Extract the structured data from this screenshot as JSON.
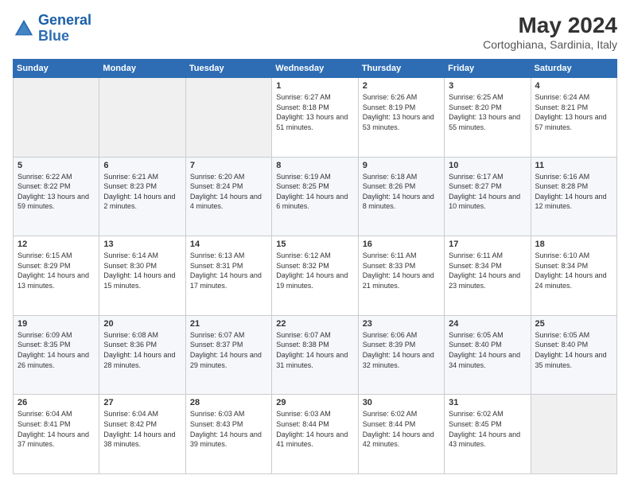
{
  "logo": {
    "line1": "General",
    "line2": "Blue"
  },
  "title": "May 2024",
  "subtitle": "Cortoghiana, Sardinia, Italy",
  "days_of_week": [
    "Sunday",
    "Monday",
    "Tuesday",
    "Wednesday",
    "Thursday",
    "Friday",
    "Saturday"
  ],
  "weeks": [
    [
      {
        "day": "",
        "sunrise": "",
        "sunset": "",
        "daylight": ""
      },
      {
        "day": "",
        "sunrise": "",
        "sunset": "",
        "daylight": ""
      },
      {
        "day": "",
        "sunrise": "",
        "sunset": "",
        "daylight": ""
      },
      {
        "day": "1",
        "sunrise": "Sunrise: 6:27 AM",
        "sunset": "Sunset: 8:18 PM",
        "daylight": "Daylight: 13 hours and 51 minutes."
      },
      {
        "day": "2",
        "sunrise": "Sunrise: 6:26 AM",
        "sunset": "Sunset: 8:19 PM",
        "daylight": "Daylight: 13 hours and 53 minutes."
      },
      {
        "day": "3",
        "sunrise": "Sunrise: 6:25 AM",
        "sunset": "Sunset: 8:20 PM",
        "daylight": "Daylight: 13 hours and 55 minutes."
      },
      {
        "day": "4",
        "sunrise": "Sunrise: 6:24 AM",
        "sunset": "Sunset: 8:21 PM",
        "daylight": "Daylight: 13 hours and 57 minutes."
      }
    ],
    [
      {
        "day": "5",
        "sunrise": "Sunrise: 6:22 AM",
        "sunset": "Sunset: 8:22 PM",
        "daylight": "Daylight: 13 hours and 59 minutes."
      },
      {
        "day": "6",
        "sunrise": "Sunrise: 6:21 AM",
        "sunset": "Sunset: 8:23 PM",
        "daylight": "Daylight: 14 hours and 2 minutes."
      },
      {
        "day": "7",
        "sunrise": "Sunrise: 6:20 AM",
        "sunset": "Sunset: 8:24 PM",
        "daylight": "Daylight: 14 hours and 4 minutes."
      },
      {
        "day": "8",
        "sunrise": "Sunrise: 6:19 AM",
        "sunset": "Sunset: 8:25 PM",
        "daylight": "Daylight: 14 hours and 6 minutes."
      },
      {
        "day": "9",
        "sunrise": "Sunrise: 6:18 AM",
        "sunset": "Sunset: 8:26 PM",
        "daylight": "Daylight: 14 hours and 8 minutes."
      },
      {
        "day": "10",
        "sunrise": "Sunrise: 6:17 AM",
        "sunset": "Sunset: 8:27 PM",
        "daylight": "Daylight: 14 hours and 10 minutes."
      },
      {
        "day": "11",
        "sunrise": "Sunrise: 6:16 AM",
        "sunset": "Sunset: 8:28 PM",
        "daylight": "Daylight: 14 hours and 12 minutes."
      }
    ],
    [
      {
        "day": "12",
        "sunrise": "Sunrise: 6:15 AM",
        "sunset": "Sunset: 8:29 PM",
        "daylight": "Daylight: 14 hours and 13 minutes."
      },
      {
        "day": "13",
        "sunrise": "Sunrise: 6:14 AM",
        "sunset": "Sunset: 8:30 PM",
        "daylight": "Daylight: 14 hours and 15 minutes."
      },
      {
        "day": "14",
        "sunrise": "Sunrise: 6:13 AM",
        "sunset": "Sunset: 8:31 PM",
        "daylight": "Daylight: 14 hours and 17 minutes."
      },
      {
        "day": "15",
        "sunrise": "Sunrise: 6:12 AM",
        "sunset": "Sunset: 8:32 PM",
        "daylight": "Daylight: 14 hours and 19 minutes."
      },
      {
        "day": "16",
        "sunrise": "Sunrise: 6:11 AM",
        "sunset": "Sunset: 8:33 PM",
        "daylight": "Daylight: 14 hours and 21 minutes."
      },
      {
        "day": "17",
        "sunrise": "Sunrise: 6:11 AM",
        "sunset": "Sunset: 8:34 PM",
        "daylight": "Daylight: 14 hours and 23 minutes."
      },
      {
        "day": "18",
        "sunrise": "Sunrise: 6:10 AM",
        "sunset": "Sunset: 8:34 PM",
        "daylight": "Daylight: 14 hours and 24 minutes."
      }
    ],
    [
      {
        "day": "19",
        "sunrise": "Sunrise: 6:09 AM",
        "sunset": "Sunset: 8:35 PM",
        "daylight": "Daylight: 14 hours and 26 minutes."
      },
      {
        "day": "20",
        "sunrise": "Sunrise: 6:08 AM",
        "sunset": "Sunset: 8:36 PM",
        "daylight": "Daylight: 14 hours and 28 minutes."
      },
      {
        "day": "21",
        "sunrise": "Sunrise: 6:07 AM",
        "sunset": "Sunset: 8:37 PM",
        "daylight": "Daylight: 14 hours and 29 minutes."
      },
      {
        "day": "22",
        "sunrise": "Sunrise: 6:07 AM",
        "sunset": "Sunset: 8:38 PM",
        "daylight": "Daylight: 14 hours and 31 minutes."
      },
      {
        "day": "23",
        "sunrise": "Sunrise: 6:06 AM",
        "sunset": "Sunset: 8:39 PM",
        "daylight": "Daylight: 14 hours and 32 minutes."
      },
      {
        "day": "24",
        "sunrise": "Sunrise: 6:05 AM",
        "sunset": "Sunset: 8:40 PM",
        "daylight": "Daylight: 14 hours and 34 minutes."
      },
      {
        "day": "25",
        "sunrise": "Sunrise: 6:05 AM",
        "sunset": "Sunset: 8:40 PM",
        "daylight": "Daylight: 14 hours and 35 minutes."
      }
    ],
    [
      {
        "day": "26",
        "sunrise": "Sunrise: 6:04 AM",
        "sunset": "Sunset: 8:41 PM",
        "daylight": "Daylight: 14 hours and 37 minutes."
      },
      {
        "day": "27",
        "sunrise": "Sunrise: 6:04 AM",
        "sunset": "Sunset: 8:42 PM",
        "daylight": "Daylight: 14 hours and 38 minutes."
      },
      {
        "day": "28",
        "sunrise": "Sunrise: 6:03 AM",
        "sunset": "Sunset: 8:43 PM",
        "daylight": "Daylight: 14 hours and 39 minutes."
      },
      {
        "day": "29",
        "sunrise": "Sunrise: 6:03 AM",
        "sunset": "Sunset: 8:44 PM",
        "daylight": "Daylight: 14 hours and 41 minutes."
      },
      {
        "day": "30",
        "sunrise": "Sunrise: 6:02 AM",
        "sunset": "Sunset: 8:44 PM",
        "daylight": "Daylight: 14 hours and 42 minutes."
      },
      {
        "day": "31",
        "sunrise": "Sunrise: 6:02 AM",
        "sunset": "Sunset: 8:45 PM",
        "daylight": "Daylight: 14 hours and 43 minutes."
      },
      {
        "day": "",
        "sunrise": "",
        "sunset": "",
        "daylight": ""
      }
    ]
  ]
}
